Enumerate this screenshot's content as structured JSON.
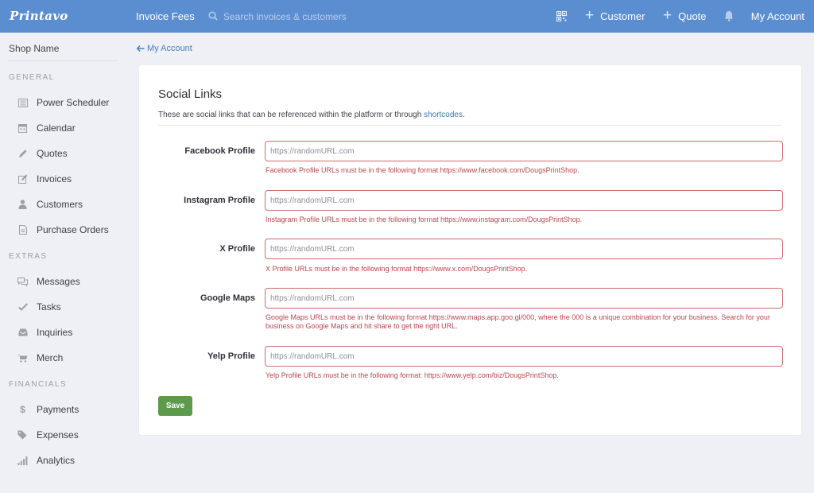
{
  "topbar": {
    "logo": "Printavo",
    "invoice_fees": "Invoice Fees",
    "search_placeholder": "Search invoices & customers",
    "customer_label": "Customer",
    "quote_label": "Quote",
    "account_label": "My Account",
    "background": "#5b8ed1"
  },
  "sidebar": {
    "shop_name": "Shop Name",
    "general_title": "GENERAL",
    "general_items": [
      "Power Scheduler",
      "Calendar",
      "Quotes",
      "Invoices",
      "Customers",
      "Purchase Orders"
    ],
    "extras_title": "EXTRAS",
    "extras_items": [
      "Messages",
      "Tasks",
      "Inquiries",
      "Merch"
    ],
    "financials_title": "FINANCIALS",
    "financials_items": [
      "Payments",
      "Expenses",
      "Analytics"
    ]
  },
  "main": {
    "back_label": "My Account",
    "title": "Social Links",
    "description": "These are social links that can be referenced within the platform or through",
    "description_link": "shortcodes",
    "description_end": ".",
    "fields": [
      {
        "label": "Facebook Profile",
        "placeholder": "https://randomURL.com",
        "error": "Facebook Profile URLs must be in the following format https://www.facebook.com/DougsPrintShop."
      },
      {
        "label": "Instagram Profile",
        "placeholder": "https://randomURL.com",
        "error": "Instagram Profile URLs must be in the following format https://www.instagram.com/DougsPrintShop."
      },
      {
        "label": "X Profile",
        "placeholder": "https://randomURL.com",
        "error": "X Profile URLs must be in the following format https://www.x.com/DougsPrintShop."
      },
      {
        "label": "Google Maps",
        "placeholder": "https://randomURL.com",
        "error": "Google Maps URLs must be in the following format https://www.maps.app.goo.gl/000, where the 000 is a unique combination for your business. Search for your business on Google Maps and hit share to get the right URL."
      },
      {
        "label": "Yelp Profile",
        "placeholder": "https://randomURL.com",
        "error": "Yelp Profile URLs must be in the following format: https://www.yelp.com/biz/DougsPrintShop."
      }
    ],
    "save_label": "Save",
    "error_color": "#c0454d",
    "save_color": "#5d9a4e"
  }
}
